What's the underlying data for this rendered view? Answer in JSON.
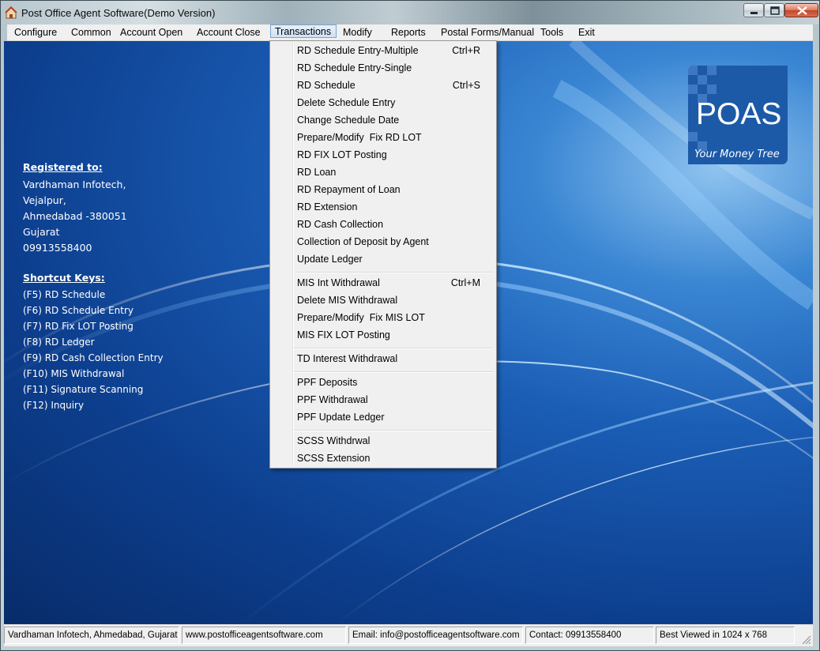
{
  "window": {
    "title": "Post Office Agent Software(Demo Version)",
    "icon": "app-icon",
    "controls": [
      "minimize-icon",
      "maximize-icon",
      "close-icon"
    ]
  },
  "menubar": {
    "items": [
      "Configure",
      "Common",
      "Account Open",
      "Account Close",
      "Transactions",
      "Modify",
      "Reports",
      "Postal Forms/Manual",
      "Tools",
      "Exit"
    ],
    "active": "Transactions"
  },
  "transactions_menu": {
    "group1": [
      {
        "label": "RD Schedule Entry-Multiple",
        "shortcut": "Ctrl+R"
      },
      {
        "label": "RD Schedule Entry-Single",
        "shortcut": ""
      },
      {
        "label": "RD Schedule",
        "shortcut": "Ctrl+S"
      },
      {
        "label": "Delete Schedule Entry",
        "shortcut": ""
      },
      {
        "label": "Change Schedule Date",
        "shortcut": ""
      },
      {
        "label": "Prepare/Modify  Fix RD LOT",
        "shortcut": ""
      },
      {
        "label": "RD FIX LOT Posting",
        "shortcut": ""
      },
      {
        "label": "RD Loan",
        "shortcut": ""
      },
      {
        "label": "RD Repayment of Loan",
        "shortcut": ""
      },
      {
        "label": "RD Extension",
        "shortcut": ""
      },
      {
        "label": "RD Cash Collection",
        "shortcut": ""
      },
      {
        "label": "Collection of Deposit by Agent",
        "shortcut": ""
      },
      {
        "label": "Update Ledger",
        "shortcut": ""
      }
    ],
    "group2": [
      {
        "label": "MIS Int Withdrawal",
        "shortcut": "Ctrl+M"
      },
      {
        "label": "Delete MIS Withdrawal",
        "shortcut": ""
      },
      {
        "label": "Prepare/Modify  Fix MIS LOT",
        "shortcut": ""
      },
      {
        "label": "MIS FIX LOT Posting",
        "shortcut": ""
      }
    ],
    "group3": [
      {
        "label": "TD Interest Withdrawal",
        "shortcut": ""
      }
    ],
    "group4": [
      {
        "label": "PPF Deposits",
        "shortcut": ""
      },
      {
        "label": "PPF Withdrawal",
        "shortcut": ""
      },
      {
        "label": "PPF Update Ledger",
        "shortcut": ""
      }
    ],
    "group5": [
      {
        "label": "SCSS Withdrwal",
        "shortcut": ""
      },
      {
        "label": "SCSS Extension",
        "shortcut": ""
      }
    ]
  },
  "registration": {
    "heading": "Registered to:",
    "lines": [
      "Vardhaman Infotech,",
      "Vejalpur,",
      "Ahmedabad -380051",
      "Gujarat",
      "09913558400"
    ]
  },
  "shortcuts": {
    "heading": "Shortcut Keys:",
    "lines": [
      "(F5) RD Schedule",
      "(F6) RD Schedule Entry",
      "(F7) RD Fix LOT Posting",
      "(F8) RD Ledger",
      "(F9) RD Cash Collection Entry",
      "(F10) MIS Withdrawal",
      "(F11) Signature Scanning",
      "(F12) Inquiry"
    ]
  },
  "logo": {
    "name": "POAS",
    "tagline": "Your Money Tree"
  },
  "statusbar": {
    "panels": [
      "Vardhaman Infotech, Ahmedabad, Gujarat",
      "www.postofficeagentsoftware.com",
      "Email: info@postofficeagentsoftware.com",
      "Contact: 09913558400",
      "Best Viewed in 1024 x 768"
    ]
  },
  "colors": {
    "menu_bg": "#f0f0f0",
    "desktop_blue": "#1b5eb6",
    "logo_blue": "#1c5aa8",
    "highlight_border": "#7da2ce"
  }
}
